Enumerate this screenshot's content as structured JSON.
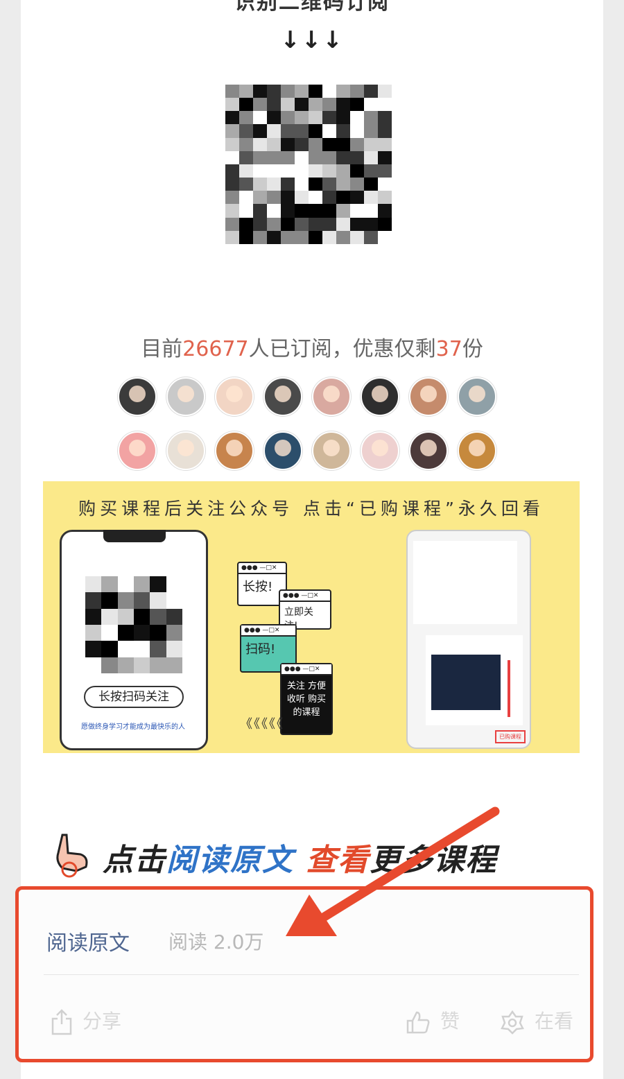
{
  "article": {
    "top_heading": "识别二维码订阅",
    "arrows": "↓↓↓",
    "stats": {
      "prefix": "目前",
      "subscribers": "26677",
      "middle": "人已订阅，优惠仅剩",
      "remaining": "37",
      "suffix": "份"
    }
  },
  "banner": {
    "title": "购买课程后关注公众号 点击“已购课程”永久回看",
    "scan_label": "长按扫码关注",
    "tagline": "愿做终身学习才能成为最快乐的人",
    "step1": "长按!",
    "step2": "立即关注!",
    "step3": "扫码!",
    "step4": "关注 方便收听 购买的课程",
    "chevrons": "《《《《《",
    "bought_tab": "已购课程"
  },
  "cta": {
    "prefix": "点击",
    "blue": "阅读原文",
    "red": "查看",
    "suffix": "更多课程"
  },
  "footer": {
    "read_original": "阅读原文",
    "read_count": "阅读 2.0万",
    "share": "分享",
    "like": "赞",
    "watching": "在看"
  },
  "colors": {
    "highlight": "#e0624c",
    "link": "#4f6690",
    "annotation": "#e84a2e",
    "banner_bg": "#fbe98a"
  }
}
